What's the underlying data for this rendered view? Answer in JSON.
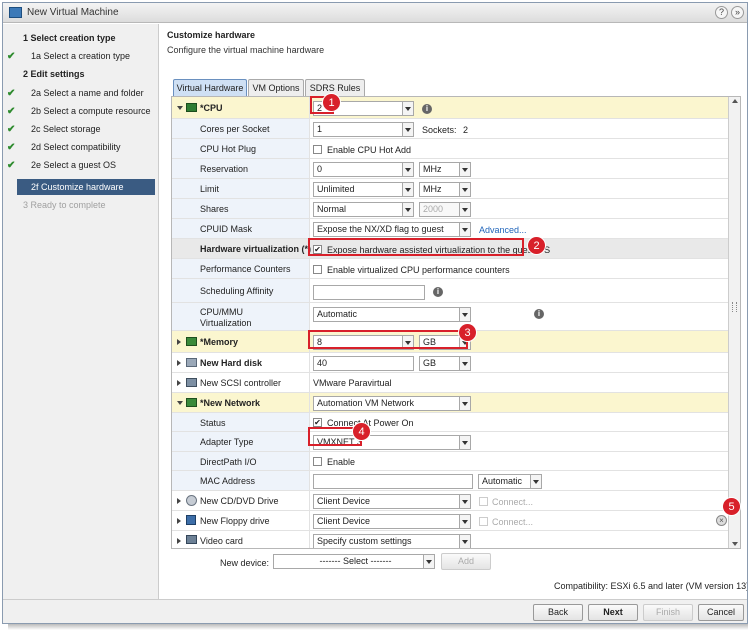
{
  "window": {
    "title": "New Virtual Machine",
    "help": "?",
    "expand": "»"
  },
  "steps": [
    {
      "label": "1  Select creation type",
      "bold": true,
      "check": false,
      "state": "done"
    },
    {
      "label": "1a  Select a creation type",
      "bold": false,
      "check": true,
      "state": "done"
    },
    {
      "label": "2  Edit settings",
      "bold": true,
      "check": false,
      "state": "done"
    },
    {
      "label": "2a  Select a name and folder",
      "bold": false,
      "check": true,
      "state": "done"
    },
    {
      "label": "2b  Select a compute resource",
      "bold": false,
      "check": true,
      "state": "done"
    },
    {
      "label": "2c  Select storage",
      "bold": false,
      "check": true,
      "state": "done"
    },
    {
      "label": "2d  Select compatibility",
      "bold": false,
      "check": true,
      "state": "done"
    },
    {
      "label": "2e  Select a guest OS",
      "bold": false,
      "check": true,
      "state": "done"
    },
    {
      "label": "2f  Customize hardware",
      "bold": false,
      "check": false,
      "state": "active"
    },
    {
      "label": "3  Ready to complete",
      "bold": false,
      "check": false,
      "state": "disabled"
    }
  ],
  "header": {
    "title": "Customize hardware",
    "subtitle": "Configure the virtual machine hardware"
  },
  "tabs": [
    "Virtual Hardware",
    "VM Options",
    "SDRS Rules"
  ],
  "hw": {
    "cpu": {
      "label": "*CPU",
      "value": "2",
      "cores_label": "Cores per Socket",
      "cores": "1",
      "sockets_label": "Sockets:",
      "sockets": "2",
      "hotplug_label": "CPU Hot Plug",
      "hotplug_text": "Enable CPU Hot Add",
      "reservation_label": "Reservation",
      "reservation": "0",
      "reservation_unit": "MHz",
      "limit_label": "Limit",
      "limit": "Unlimited",
      "limit_unit": "MHz",
      "shares_label": "Shares",
      "shares": "Normal",
      "shares_value": "2000",
      "cpuid_label": "CPUID Mask",
      "cpuid": "Expose the NX/XD flag to guest",
      "advanced": "Advanced...",
      "hwvirt_label": "Hardware virtualization (*)",
      "hwvirt_text": "Expose hardware assisted virtualization to the guest OS",
      "perf_label": "Performance Counters",
      "perf_text": "Enable virtualized CPU performance counters",
      "affinity_label": "Scheduling Affinity",
      "affinity": "",
      "mmu_label1": "CPU/MMU",
      "mmu_label2": "Virtualization",
      "mmu": "Automatic"
    },
    "memory": {
      "label": "*Memory",
      "value": "8",
      "unit": "GB"
    },
    "disk": {
      "label": "New Hard disk",
      "value": "40",
      "unit": "GB"
    },
    "scsi": {
      "label": "New SCSI controller",
      "value": "VMware Paravirtual"
    },
    "network": {
      "label": "*New Network",
      "value": "Automation VM Network",
      "status_label": "Status",
      "status_text": "Connect At Power On",
      "adapter_label": "Adapter Type",
      "adapter": "VMXNET 3",
      "dpio_label": "DirectPath I/O",
      "dpio_text": "Enable",
      "mac_label": "MAC Address",
      "mac": "",
      "mac_mode": "Automatic"
    },
    "cd": {
      "label": "New CD/DVD Drive",
      "value": "Client Device",
      "connect": "Connect..."
    },
    "floppy": {
      "label": "New Floppy drive",
      "value": "Client Device",
      "connect": "Connect..."
    },
    "video": {
      "label": "Video card",
      "value": "Specify custom settings"
    }
  },
  "newdevice": {
    "label": "New device:",
    "value": "------- Select -------",
    "add": "Add"
  },
  "compat": "Compatibility: ESXi 6.5 and later (VM version 13)",
  "buttons": {
    "back": "Back",
    "next": "Next",
    "finish": "Finish",
    "cancel": "Cancel"
  },
  "callouts": [
    "1",
    "2",
    "3",
    "4",
    "5"
  ]
}
